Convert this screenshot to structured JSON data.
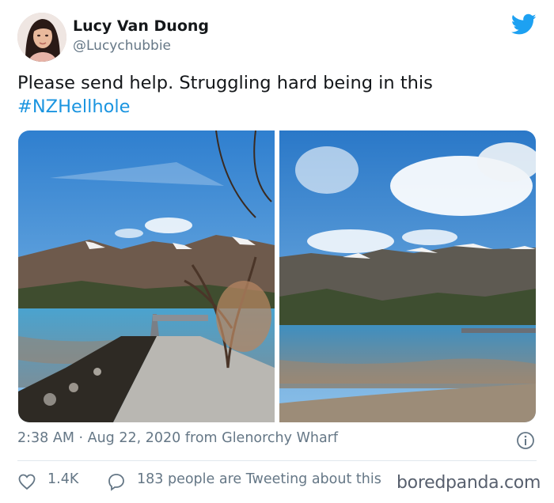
{
  "tweet": {
    "author_name": "Lucy Van Duong",
    "handle": "@Lucychubbie",
    "text_before": "Please send help. Struggling hard being in this",
    "hashtag": "#NZHellhole",
    "timestamp": "2:38 AM · Aug 22, 2020 from Glenorchy Wharf",
    "likes": "1.4K",
    "tweeting_text": "183 people are Tweeting about this",
    "icons": {
      "brand": "twitter-bird-icon",
      "info": "info-icon",
      "like": "heart-icon",
      "reply": "speech-bubble-icon"
    },
    "colors": {
      "brand": "#1da1f2",
      "hashtag": "#1b95e0",
      "muted": "#657786"
    }
  },
  "watermark": {
    "text": "boredpanda.com"
  }
}
